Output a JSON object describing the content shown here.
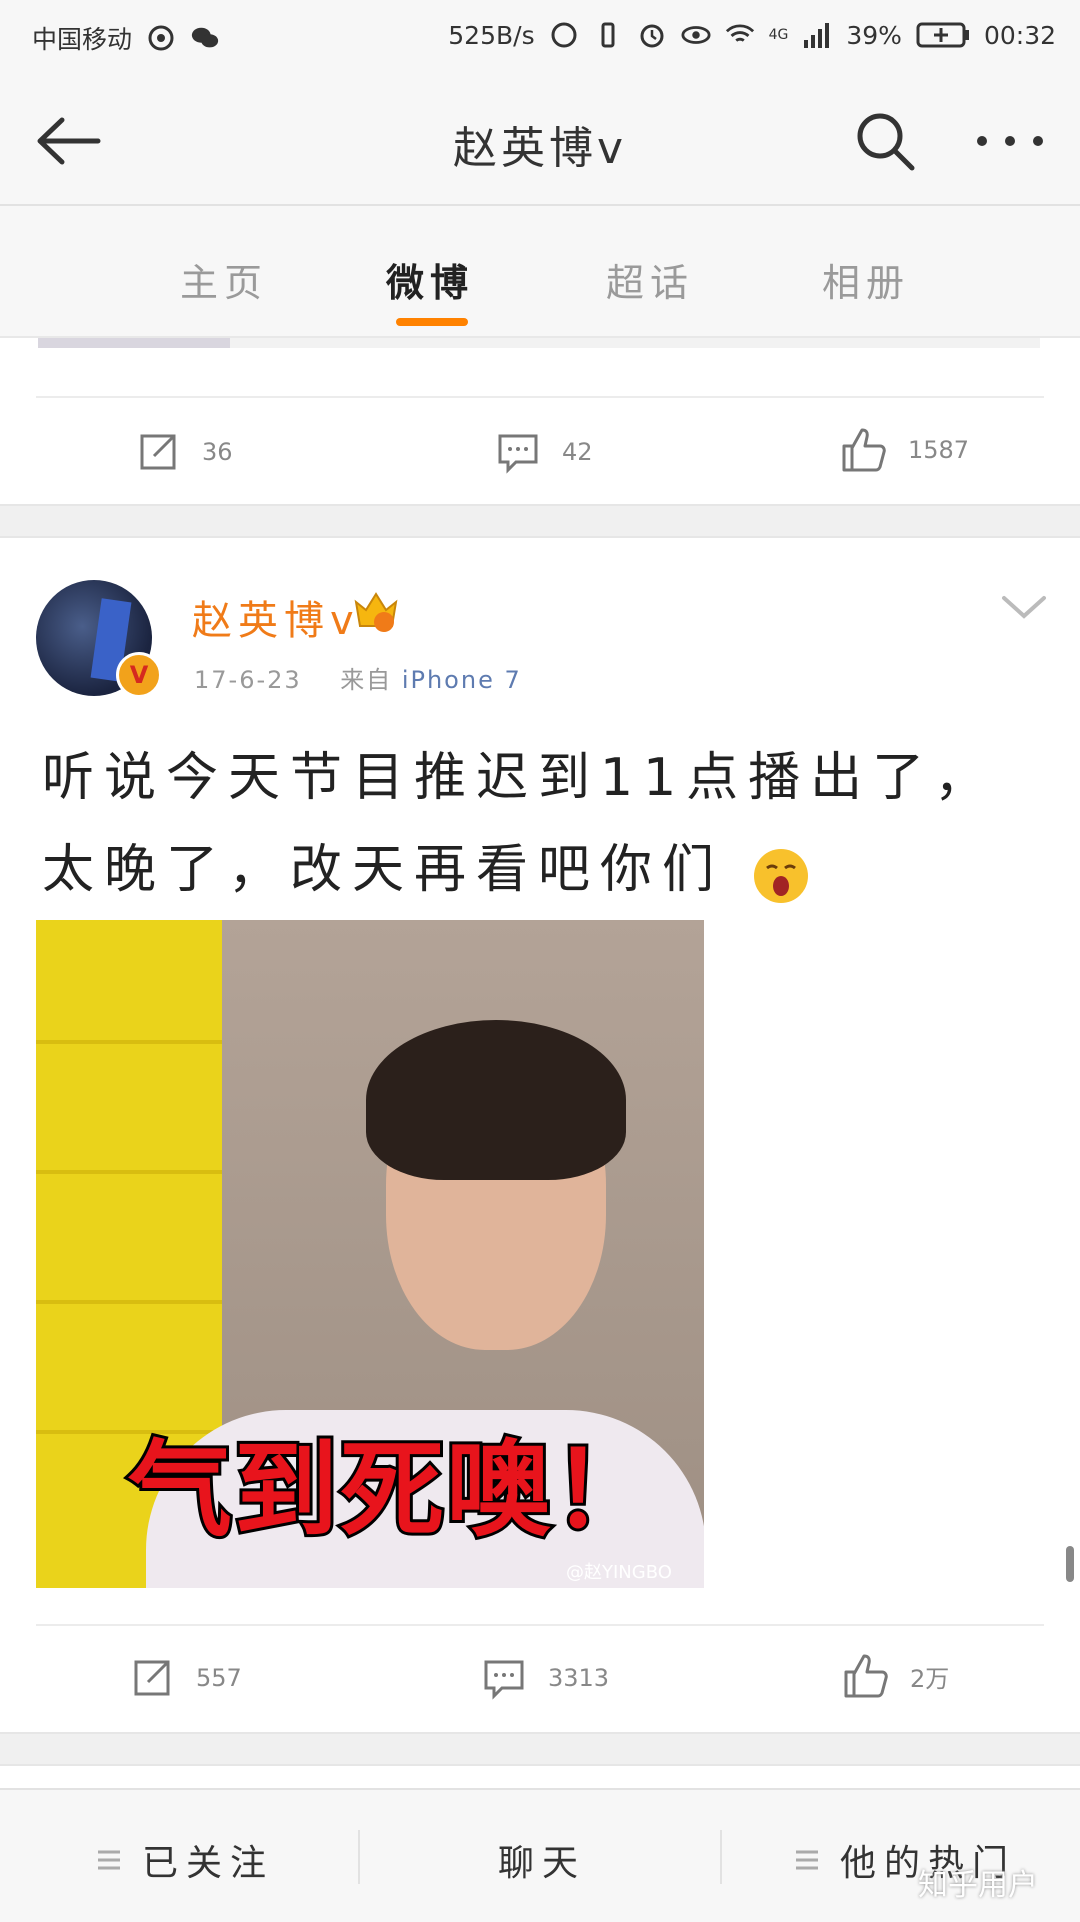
{
  "status_bar": {
    "carrier": "中国移动",
    "speed": "525B/s",
    "network": "4G",
    "battery": "39%",
    "time": "00:32"
  },
  "nav": {
    "title": "赵英博v"
  },
  "tabs": [
    {
      "label": "主页"
    },
    {
      "label": "微博"
    },
    {
      "label": "超话"
    },
    {
      "label": "相册"
    }
  ],
  "previous_post": {
    "reposts": "36",
    "comments": "42",
    "likes": "1587"
  },
  "post": {
    "username": "赵英博v",
    "date": "17-6-23",
    "source_prefix": "来自",
    "source": "iPhone 7",
    "text": "听说今天节目推迟到11点播出了，太晚了，改天再看吧你们",
    "image_caption": "气到死噢！",
    "image_watermark": "@赵YINGBO",
    "reposts": "557",
    "comments": "3313",
    "likes": "2万"
  },
  "bottom_bar": {
    "following": "已关注",
    "chat": "聊天",
    "hot": "他的热门"
  },
  "watermark": "知乎用户",
  "colors": {
    "accent": "#ff8200",
    "username": "#f07b18",
    "source_link": "#5e7bb0"
  }
}
